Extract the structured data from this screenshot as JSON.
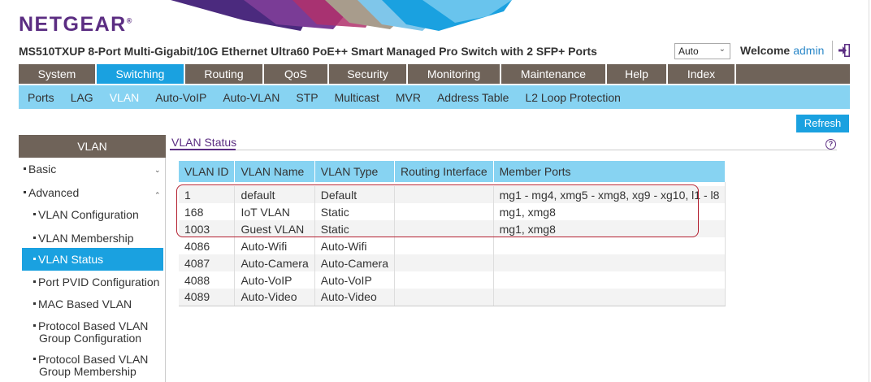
{
  "header": {
    "logo": "NETGEAR",
    "logo_mark": "®",
    "product_title": "MS510TXUP 8-Port Multi-Gigabit/10G Ethernet Ultra60 PoE++ Smart Managed Pro Switch with 2 SFP+ Ports",
    "language_select": "Auto",
    "welcome_label": "Welcome",
    "username": "admin"
  },
  "main_nav": {
    "tabs": [
      {
        "label": "System"
      },
      {
        "label": "Switching"
      },
      {
        "label": "Routing"
      },
      {
        "label": "QoS"
      },
      {
        "label": "Security"
      },
      {
        "label": "Monitoring"
      },
      {
        "label": "Maintenance"
      },
      {
        "label": "Help"
      },
      {
        "label": "Index"
      }
    ],
    "active": "Switching"
  },
  "sub_nav": {
    "items": [
      {
        "label": "Ports"
      },
      {
        "label": "LAG"
      },
      {
        "label": "VLAN"
      },
      {
        "label": "Auto-VoIP"
      },
      {
        "label": "Auto-VLAN"
      },
      {
        "label": "STP"
      },
      {
        "label": "Multicast"
      },
      {
        "label": "MVR"
      },
      {
        "label": "Address Table"
      },
      {
        "label": "L2 Loop Protection"
      }
    ],
    "active": "VLAN"
  },
  "sidebar": {
    "title": "VLAN",
    "basic": "Basic",
    "advanced": "Advanced",
    "items": [
      {
        "label": "VLAN Configuration"
      },
      {
        "label": "VLAN Membership"
      },
      {
        "label": "VLAN Status"
      },
      {
        "label": "Port PVID Configuration"
      },
      {
        "label": "MAC Based VLAN"
      },
      {
        "label_line1": "Protocol Based VLAN",
        "label_line2": "Group Configuration"
      },
      {
        "label_line1": "Protocol Based VLAN",
        "label_line2": "Group Membership"
      }
    ],
    "active": "VLAN Status"
  },
  "content": {
    "section_title": "VLAN Status",
    "refresh_label": "Refresh",
    "help_glyph": "?",
    "columns": [
      "VLAN ID",
      "VLAN Name",
      "VLAN Type",
      "Routing Interface",
      "Member Ports"
    ],
    "rows": [
      [
        "1",
        "default",
        "Default",
        "",
        "mg1 - mg4, xmg5 - xmg8, xg9 - xg10, l1 - l8"
      ],
      [
        "168",
        "IoT VLAN",
        "Static",
        "",
        "mg1, xmg8"
      ],
      [
        "1003",
        "Guest VLAN",
        "Static",
        "",
        "mg1, xmg8"
      ],
      [
        "4086",
        "Auto-Wifi",
        "Auto-Wifi",
        "",
        ""
      ],
      [
        "4087",
        "Auto-Camera",
        "Auto-Camera",
        "",
        ""
      ],
      [
        "4088",
        "Auto-VoIP",
        "Auto-VoIP",
        "",
        ""
      ],
      [
        "4089",
        "Auto-Video",
        "Auto-Video",
        "",
        ""
      ]
    ]
  },
  "colors": {
    "brand_purple": "#5b2d82",
    "nav_brown": "#6f6359",
    "accent_blue": "#1aa1e0",
    "light_blue": "#87d3f2",
    "highlight_red": "#b32030"
  }
}
